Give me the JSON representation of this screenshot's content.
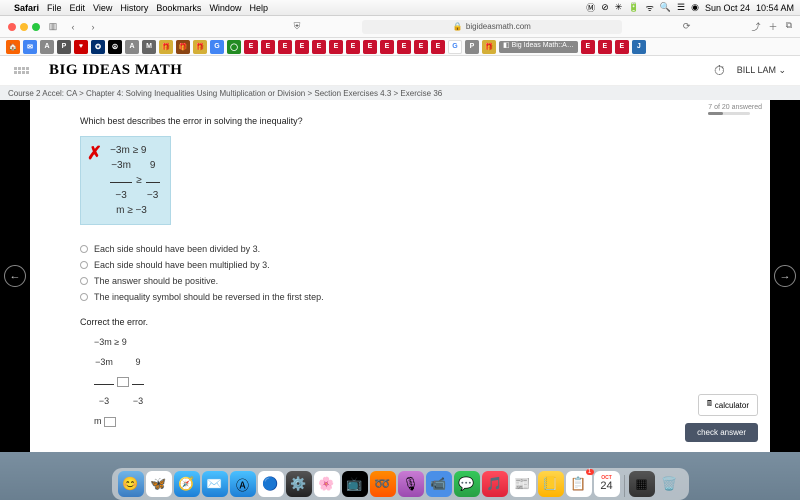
{
  "menubar": {
    "apple": "",
    "app": "Safari",
    "items": [
      "File",
      "Edit",
      "View",
      "History",
      "Bookmarks",
      "Window",
      "Help"
    ],
    "status": {
      "date": "Sun Oct 24",
      "time": "10:54 AM"
    }
  },
  "browser": {
    "url": "bigideasmath.com",
    "active_tab": "Big Ideas Math::A…"
  },
  "site": {
    "logo": "BIG IDEAS MATH",
    "user": "BILL LAM"
  },
  "breadcrumb": "Course 2 Accel: CA > Chapter 4: Solving Inequalities Using Multiplication or Division > Section Exercises 4.3 > Exercise 36",
  "progress": {
    "text": "7 of 20 answered"
  },
  "exercise": {
    "number": "36",
    "question": "Which best describes the error in solving the inequality?",
    "error_work": {
      "line1": "−3m ≥ 9",
      "line2_left_num": "−3m",
      "line2_left_den": "−3",
      "line2_op": "≥",
      "line2_right_num": "9",
      "line2_right_den": "−3",
      "line3": "m ≥ −3"
    },
    "choices": [
      "Each side should have been divided by 3.",
      "Each side should have been multiplied by 3.",
      "The answer should be positive.",
      "The inequality symbol should be reversed in the first step."
    ],
    "correct_label": "Correct the error.",
    "our_work": {
      "line1": "−3m ≥ 9",
      "frac_left_num": "−3m",
      "frac_left_den": "−3",
      "frac_right_num": "9",
      "frac_right_den": "−3",
      "final_var": "m"
    }
  },
  "buttons": {
    "calculator": "calculator",
    "check": "check answer"
  },
  "dock": {
    "cal_month": "OCT",
    "cal_day": "24",
    "badge": "1"
  }
}
